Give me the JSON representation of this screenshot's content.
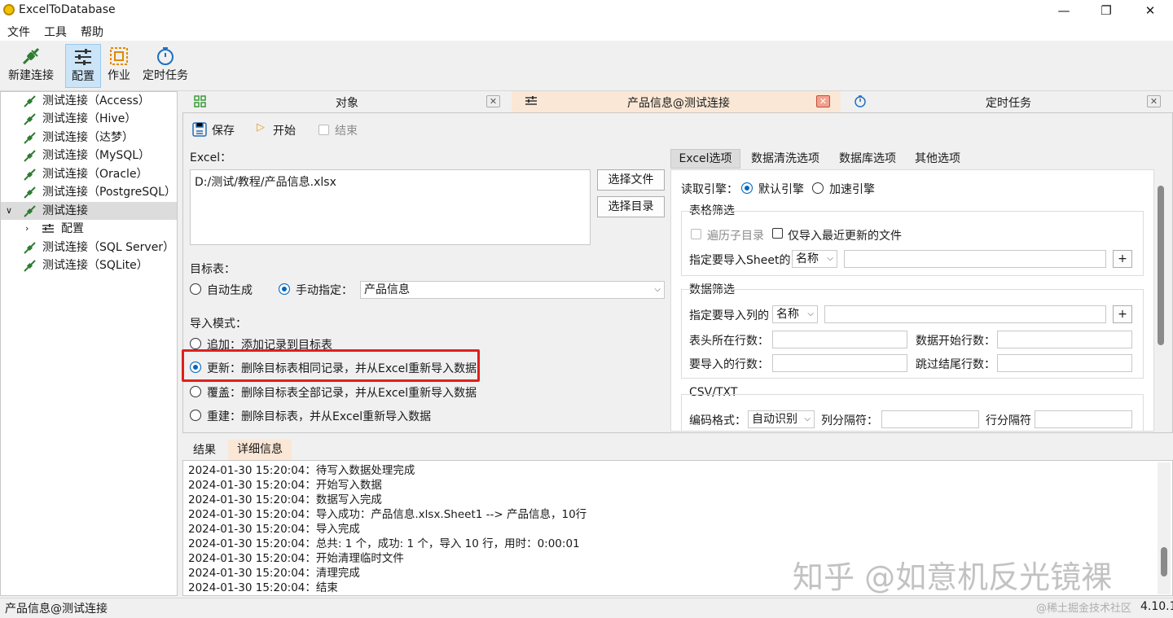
{
  "window": {
    "title": "ExcelToDatabase",
    "min": "—",
    "max": "❐",
    "close": "✕"
  },
  "menu": [
    "文件",
    "工具",
    "帮助"
  ],
  "toolbar": {
    "new_connection": "新建连接",
    "config": "配置",
    "job": "作业",
    "schedule": "定时任务"
  },
  "tree": {
    "items": [
      "测试连接（Access）",
      "测试连接（Hive）",
      "测试连接（达梦）",
      "测试连接（MySQL）",
      "测试连接（Oracle）",
      "测试连接（PostgreSQL）",
      "测试连接",
      "配置",
      "测试连接（SQL Server）",
      "测试连接（SQLite）"
    ]
  },
  "tabs": {
    "objects": "对象",
    "product": "产品信息@测试连接",
    "schedule": "定时任务"
  },
  "actions": {
    "save": "保存",
    "start": "开始",
    "end": "结束"
  },
  "excel": {
    "label": "Excel：",
    "path": "D:/测试/教程/产品信息.xlsx",
    "choose_file": "选择文件",
    "choose_dir": "选择目录"
  },
  "target": {
    "label": "目标表：",
    "auto": "自动生成",
    "manual": "手动指定：",
    "table": "产品信息"
  },
  "mode": {
    "label": "导入模式：",
    "append": "追加：添加记录到目标表",
    "update": "更新：删除目标表相同记录，并从Excel重新导入数据",
    "overwrite": "覆盖：删除目标表全部记录，并从Excel重新导入数据",
    "rebuild": "重建：删除目标表，并从Excel重新导入数据"
  },
  "right_tabs": [
    "Excel选项",
    "数据清洗选项",
    "数据库选项",
    "其他选项"
  ],
  "engine": {
    "label": "读取引擎：",
    "default": "默认引擎",
    "fast": "加速引擎"
  },
  "sheet_filter": {
    "title": "表格筛选",
    "subdirs": "遍历子目录",
    "latest_only": "仅导入最近更新的文件",
    "sheet_label": "指定要导入Sheet的",
    "sheet_mode": "名称",
    "add": "+"
  },
  "data_filter": {
    "title": "数据筛选",
    "col_label": "指定要导入列的",
    "col_mode": "名称",
    "add": "+",
    "header_row": "表头所在行数：",
    "data_start": "数据开始行数：",
    "rows_to_import": "要导入的行数：",
    "skip_tail": "跳过结尾行数："
  },
  "csv": {
    "title": "CSV/TXT",
    "encoding_label": "编码格式：",
    "encoding": "自动识别",
    "col_sep": "列分隔符：",
    "row_sep": "行分隔符"
  },
  "bottom_tabs": [
    "结果",
    "详细信息"
  ],
  "log": [
    "2024-01-30 15:20:04：待写入数据处理完成",
    "2024-01-30 15:20:04：开始写入数据",
    "2024-01-30 15:20:04：数据写入完成",
    "2024-01-30 15:20:04：导入成功：产品信息.xlsx.Sheet1 --> 产品信息，10行",
    "2024-01-30 15:20:04：导入完成",
    "2024-01-30 15:20:04：总共: 1 个，成功: 1 个，导入 10 行，用时：0:00:01",
    "2024-01-30 15:20:04：开始清理临时文件",
    "2024-01-30 15:20:04：清理完成",
    "2024-01-30 15:20:04：结束"
  ],
  "status": {
    "left": "产品信息@测试连接",
    "version": "4.10.1"
  },
  "watermark": {
    "zhihu": "知乎 @如意机反光镜裸",
    "juejin": "@稀土掘金技术社区"
  }
}
